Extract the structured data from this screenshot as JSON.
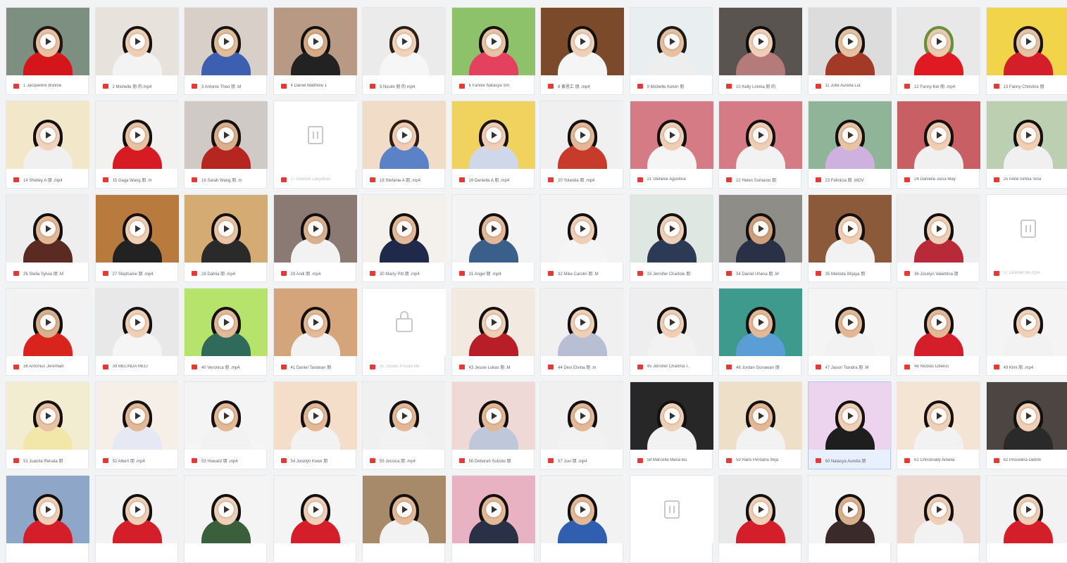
{
  "play_icon": "play-circle-icon",
  "file_icon": "video-file-icon",
  "colors": {
    "file_icon": "#e53935",
    "play": "#ffffff",
    "selected_tile": "#e8f0fe"
  },
  "tiles": [
    {
      "kind": "video",
      "label": "1 Jacqueline Bonnie",
      "bg": "#7d8f80",
      "skin": "#e8c2a0",
      "shirt": "#d4161b",
      "hair": "#1c1512"
    },
    {
      "kind": "video",
      "label": "2 Michelle 朋 的.mp4",
      "bg": "#e7e2dc",
      "skin": "#efcfb4",
      "shirt": "#f3f3f3",
      "hair": "#181212"
    },
    {
      "kind": "video",
      "label": "3 Antonio Theo 朋 .M",
      "bg": "#d8d0c8",
      "skin": "#e3bc98",
      "shirt": "#3d5fb0",
      "hair": "#151515"
    },
    {
      "kind": "video",
      "label": "4 Daniel Matthew 1",
      "bg": "#b89a84",
      "skin": "#d7a984",
      "shirt": "#222222",
      "hair": "#111111"
    },
    {
      "kind": "video",
      "label": "5 Nicole 朋 的.mp4",
      "bg": "#ebebeb",
      "skin": "#f2d2b8",
      "shirt": "#f6f6f6",
      "hair": "#2a1e18"
    },
    {
      "kind": "video",
      "label": "6 Fannie Natasya Sm",
      "bg": "#8dc16a",
      "skin": "#e7c3a3",
      "shirt": "#e3415e",
      "hair": "#161111"
    },
    {
      "kind": "video",
      "label": "8 黄恩汇 朋 .mp4",
      "bg": "#7a4a2b",
      "skin": "#efcfb6",
      "shirt": "#f5f5f5",
      "hair": "#131010"
    },
    {
      "kind": "video",
      "label": "9 Michelle Kelvin 朋",
      "bg": "#e9eef0",
      "skin": "#e6c0a0",
      "shirt": "#eeeeee",
      "hair": "#1a1a1a"
    },
    {
      "kind": "video",
      "label": "10 Kelly Lirinka 朋 的",
      "bg": "#5a5450",
      "skin": "#efcfb6",
      "shirt": "#b57a7a",
      "hair": "#0e0e0e"
    },
    {
      "kind": "video",
      "label": "11 Jolie Aurelia Lia",
      "bg": "#dcdcdc",
      "skin": "#e6c1a1",
      "shirt": "#a33a28",
      "hair": "#111111"
    },
    {
      "kind": "video",
      "label": "12 Fanny Kei 朋 .mp4",
      "bg": "#e8e8e8",
      "skin": "#eacbb0",
      "shirt": "#e01a22",
      "hair": "#6a8f3a"
    },
    {
      "kind": "video",
      "label": "13 Fanny Christine 朋",
      "bg": "#f2d44a",
      "skin": "#e6c2a2",
      "shirt": "#d41e2a",
      "hair": "#1b1313"
    },
    {
      "kind": "video",
      "label": "14 Shelley A 朋 .mp4",
      "bg": "#f3e7c9",
      "skin": "#f1d3bb",
      "shirt": "#f0f0f0",
      "hair": "#151010"
    },
    {
      "kind": "video",
      "label": "15 Gaga Wang 朋 .m",
      "bg": "#f3f1ef",
      "skin": "#e8c3a3",
      "shirt": "#d71b24",
      "hair": "#141010"
    },
    {
      "kind": "video",
      "label": "16 Sarah Wang 朋 .m",
      "bg": "#cfcac6",
      "skin": "#d9b08e",
      "shirt": "#b62621",
      "hair": "#141010"
    },
    {
      "kind": "placeholder",
      "label": "17 Deleted Lanjutkan"
    },
    {
      "kind": "video",
      "label": "18 Stefanie A 朋 .mp4",
      "bg": "#f1dcc7",
      "skin": "#f0ceb4",
      "shirt": "#5b82c6",
      "hair": "#2a1b14"
    },
    {
      "kind": "video",
      "label": "19 Daniella A 朋 .mp4",
      "bg": "#f0d35e",
      "skin": "#f0ceb4",
      "shirt": "#cfd8ea",
      "hair": "#181212"
    },
    {
      "kind": "video",
      "label": "20 Yolanda 朋 .mp4",
      "bg": "#f0f0f0",
      "skin": "#e3b896",
      "shirt": "#c63b2a",
      "hair": "#141010"
    },
    {
      "kind": "video",
      "label": "21 Stefanie Agustina",
      "bg": "#d47b85",
      "skin": "#f0ceb4",
      "shirt": "#f5f5f5",
      "hair": "#141010"
    },
    {
      "kind": "video",
      "label": "22 Helen Sumasto 朋",
      "bg": "#d47b85",
      "skin": "#f0ceb4",
      "shirt": "#f2f2f2",
      "hair": "#141010"
    },
    {
      "kind": "video",
      "label": "23 Felinicia 朋 .MOV",
      "bg": "#8fb497",
      "skin": "#e8c3a3",
      "shirt": "#cfb1e0",
      "hair": "#141010"
    },
    {
      "kind": "video",
      "label": "24 Daniella Jucia May",
      "bg": "#c85f64",
      "skin": "#f0ceb4",
      "shirt": "#f0f0f0",
      "hair": "#141010"
    },
    {
      "kind": "video",
      "label": "25 Irene nimna Sina",
      "bg": "#bccfb0",
      "skin": "#f0ceb4",
      "shirt": "#f0f0f0",
      "hair": "#141010"
    },
    {
      "kind": "video",
      "label": "26 Stella Sylvia 朋 .M",
      "bg": "#eeeeee",
      "skin": "#e3b896",
      "shirt": "#5b2a22",
      "hair": "#141010"
    },
    {
      "kind": "video",
      "label": "27 Stephanie 朋 .mp4",
      "bg": "#b97a3e",
      "skin": "#f0ceb4",
      "shirt": "#222222",
      "hair": "#141010"
    },
    {
      "kind": "video",
      "label": "28 Dahlia 朋 .mp4",
      "bg": "#d4ab72",
      "skin": "#e9c4a4",
      "shirt": "#2a2a2a",
      "hair": "#141010"
    },
    {
      "kind": "video",
      "label": "29 Andi 朋 .mp4",
      "bg": "#8a7a73",
      "skin": "#d9b08e",
      "shirt": "#f2f2f2",
      "hair": "#141010"
    },
    {
      "kind": "video",
      "label": "30 Marry Pitt 朋 .mp4",
      "bg": "#f4f1ec",
      "skin": "#e3b896",
      "shirt": "#1f2a4a",
      "hair": "#141010"
    },
    {
      "kind": "video",
      "label": "31 Angel 朋 .mp4",
      "bg": "#f3f3f3",
      "skin": "#e3b896",
      "shirt": "#3a5f8a",
      "hair": "#141010"
    },
    {
      "kind": "video",
      "label": "32 Mike Carolin 朋 .M",
      "bg": "#f3f3f3",
      "skin": "#efcfb6",
      "shirt": "#f5f5f5",
      "hair": "#141010"
    },
    {
      "kind": "video",
      "label": "33 Jennifer Charlote 朋",
      "bg": "#dfe7e3",
      "skin": "#efcfb6",
      "shirt": "#2c3a56",
      "hair": "#141010"
    },
    {
      "kind": "video",
      "label": "34 Daniel Uhena 朋 .M",
      "bg": "#8f8d88",
      "skin": "#cfa07c",
      "shirt": "#2a3146",
      "hair": "#141010"
    },
    {
      "kind": "video",
      "label": "35 Melinda Wijaya 朋",
      "bg": "#8b5a3a",
      "skin": "#f0ceb4",
      "shirt": "#f2f2f2",
      "hair": "#141010"
    },
    {
      "kind": "video",
      "label": "36 Jocelyn Valentina 朋",
      "bg": "#eeeeee",
      "skin": "#efcfb6",
      "shirt": "#b82a38",
      "hair": "#141010"
    },
    {
      "kind": "placeholder",
      "label": "37 Deleted file.mp4"
    },
    {
      "kind": "video",
      "label": "38 Antonius Jeremiah",
      "bg": "#f2f2f2",
      "skin": "#d9b08e",
      "shirt": "#d8241c",
      "hair": "#141010"
    },
    {
      "kind": "video",
      "label": "39 MELINDA MELI",
      "bg": "#e8e8e8",
      "skin": "#efcfb6",
      "shirt": "#f5f5f5",
      "hair": "#141010"
    },
    {
      "kind": "video",
      "label": "40 Veronica 朋 .mp4",
      "bg": "#b6e36c",
      "skin": "#e3b896",
      "shirt": "#2f6a5a",
      "hair": "#141010"
    },
    {
      "kind": "video",
      "label": "41 Daniel Tandean 朋",
      "bg": "#d4a47a",
      "skin": "#e3b896",
      "shirt": "#f2f2f2",
      "hair": "#141010"
    },
    {
      "kind": "lock",
      "label": "42 Jordan Private file"
    },
    {
      "kind": "video",
      "label": "43 Jessie Lukas 朋 .M",
      "bg": "#f2e9e0",
      "skin": "#efcfb6",
      "shirt": "#b81e28",
      "hair": "#141010"
    },
    {
      "kind": "video",
      "label": "44 Devi Elvina 朋 .m",
      "bg": "#f0f0f0",
      "skin": "#efcfb6",
      "shirt": "#b8bfd4",
      "hair": "#141010"
    },
    {
      "kind": "video",
      "label": "45 Jennifer Charlina T.",
      "bg": "#eeeeee",
      "skin": "#efcfb6",
      "shirt": "#f2f2f2",
      "hair": "#141010"
    },
    {
      "kind": "video",
      "label": "46 Jordan Gunawan 朋",
      "bg": "#3d9a8c",
      "skin": "#e3b896",
      "shirt": "#5b9ed6",
      "hair": "#141010"
    },
    {
      "kind": "video",
      "label": "47 Jason Tiandra 朋 .M",
      "bg": "#f4f4f4",
      "skin": "#e3b896",
      "shirt": "#f2f2f2",
      "hair": "#141010"
    },
    {
      "kind": "video",
      "label": "48 Nicolas Liberus",
      "bg": "#f4f4f4",
      "skin": "#e3b896",
      "shirt": "#d41e2a",
      "hair": "#141010"
    },
    {
      "kind": "video",
      "label": "49 Kimi 朋 .mp4",
      "bg": "#f4f4f4",
      "skin": "#efcfb6",
      "shirt": "#f2f2f2",
      "hair": "#141010"
    },
    {
      "kind": "video",
      "label": "51 Juanita Renata 朋",
      "bg": "#f2ecd0",
      "skin": "#e8c3a3",
      "shirt": "#f2e7a8",
      "hair": "#141010"
    },
    {
      "kind": "video",
      "label": "52 Albert 朋 .mp4",
      "bg": "#f6efe8",
      "skin": "#e3b896",
      "shirt": "#e6e8f4",
      "hair": "#141010"
    },
    {
      "kind": "video",
      "label": "53 Howard 朋 .mp4",
      "bg": "#f4f4f4",
      "skin": "#e3b896",
      "shirt": "#f2f2f2",
      "hair": "#141010"
    },
    {
      "kind": "video",
      "label": "54 Jocelyn Kwek 朋",
      "bg": "#f4ddc9",
      "skin": "#e3b896",
      "shirt": "#f2f2f2",
      "hair": "#141010"
    },
    {
      "kind": "video",
      "label": "55 Jessica 朋 .mp4",
      "bg": "#f0f0f0",
      "skin": "#e3b896",
      "shirt": "#f2f2f2",
      "hair": "#141010"
    },
    {
      "kind": "video",
      "label": "56 Deborah Sulistio 朋",
      "bg": "#eed9d6",
      "skin": "#e3b896",
      "shirt": "#bfc7da",
      "hair": "#141010"
    },
    {
      "kind": "video",
      "label": "57 Juvi 朋 .mp4",
      "bg": "#f0f0f0",
      "skin": "#e3b896",
      "shirt": "#f2f2f2",
      "hair": "#141010"
    },
    {
      "kind": "video",
      "label": "58 Marcella Maria Bu",
      "bg": "#272727",
      "skin": "#efcfb6",
      "shirt": "#f2f2f2",
      "hair": "#141010"
    },
    {
      "kind": "video",
      "label": "59 Hans Perdana Wija",
      "bg": "#eedfc9",
      "skin": "#e3b896",
      "shirt": "#f2f2f2",
      "hair": "#141010"
    },
    {
      "kind": "video",
      "label": "60 Natasya Aurelia 朋",
      "bg": "#ecd3ee",
      "skin": "#efcfb6",
      "shirt": "#1e1e1e",
      "hair": "#141010",
      "selected": true
    },
    {
      "kind": "video",
      "label": "61 Christinally Amelia",
      "bg": "#f4e4d4",
      "skin": "#efcfb6",
      "shirt": "#f2f2f2",
      "hair": "#141010"
    },
    {
      "kind": "video",
      "label": "62 Prisselina Debriti",
      "bg": "#4c4542",
      "skin": "#efcfb6",
      "shirt": "#2a2a2a",
      "hair": "#141010"
    },
    {
      "kind": "video",
      "label": "",
      "bg": "#8ea6c7",
      "skin": "#efcfb6",
      "shirt": "#d41e2a",
      "hair": "#141010"
    },
    {
      "kind": "video",
      "label": "",
      "bg": "#f2f2f2",
      "skin": "#efcfb6",
      "shirt": "#d41e2a",
      "hair": "#141010"
    },
    {
      "kind": "video",
      "label": "",
      "bg": "#f4f4f4",
      "skin": "#efcfb6",
      "shirt": "#3a5f3a",
      "hair": "#141010"
    },
    {
      "kind": "video",
      "label": "",
      "bg": "#f4f4f4",
      "skin": "#efcfb6",
      "shirt": "#d41e2a",
      "hair": "#141010"
    },
    {
      "kind": "video",
      "label": "",
      "bg": "#a78a6a",
      "skin": "#e3b896",
      "shirt": "#f2f2f2",
      "hair": "#141010"
    },
    {
      "kind": "video",
      "label": "",
      "bg": "#e9b2c3",
      "skin": "#e3b896",
      "shirt": "#2a3146",
      "hair": "#141010"
    },
    {
      "kind": "video",
      "label": "",
      "bg": "#f2f2f2",
      "skin": "#e3b896",
      "shirt": "#2f5fae",
      "hair": "#141010"
    },
    {
      "kind": "placeholder",
      "label": ""
    },
    {
      "kind": "video",
      "label": "",
      "bg": "#e9e9e9",
      "skin": "#efcfb6",
      "shirt": "#d41e2a",
      "hair": "#141010"
    },
    {
      "kind": "video",
      "label": "",
      "bg": "#f4f4f4",
      "skin": "#d9b08e",
      "shirt": "#3a2a2a",
      "hair": "#141010"
    },
    {
      "kind": "video",
      "label": "",
      "bg": "#eed9d0",
      "skin": "#efcfb6",
      "shirt": "#f2f2f2",
      "hair": "#141010"
    },
    {
      "kind": "video",
      "label": "",
      "bg": "#f2f2f2",
      "skin": "#efcfb6",
      "shirt": "#d41e2a",
      "hair": "#141010"
    }
  ]
}
